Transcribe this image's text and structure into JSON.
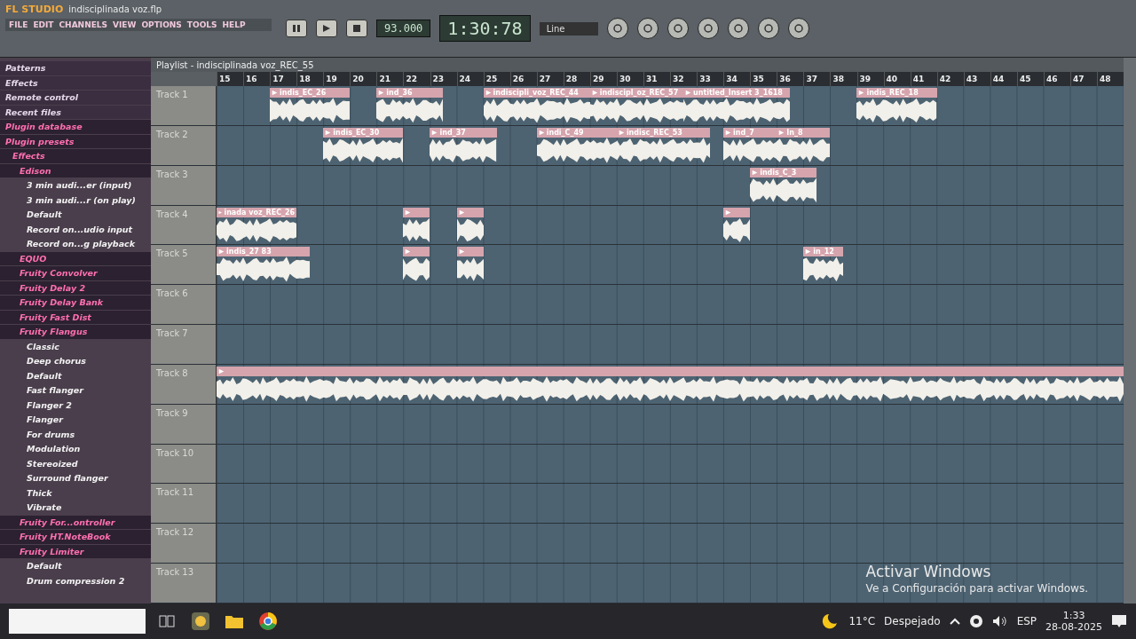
{
  "app": {
    "logo": "FL STUDIO",
    "project": "indisciplinada voz.flp",
    "menu": [
      "FILE",
      "EDIT",
      "CHANNELS",
      "VIEW",
      "OPTIONS",
      "TOOLS",
      "HELP"
    ],
    "tempo": "93.000",
    "time": "1:30:78",
    "snap": "Line"
  },
  "playlist": {
    "title": "Playlist - indisciplinada voz_REC_55",
    "bars": [
      "15",
      "16",
      "17",
      "18",
      "19",
      "20",
      "21",
      "22",
      "23",
      "24",
      "25",
      "26",
      "27",
      "28",
      "29",
      "30",
      "31",
      "32",
      "33",
      "34",
      "35",
      "36",
      "37",
      "38",
      "39",
      "40",
      "41",
      "42",
      "43",
      "44",
      "45",
      "46",
      "47",
      "48"
    ],
    "tracks": [
      {
        "name": "Track 1",
        "clips": [
          {
            "kind": "audio",
            "label": "indis_EC_26"
          },
          {
            "kind": "audio",
            "label": "ind_36"
          },
          {
            "kind": "audio",
            "label": "indiscipli_voz_REC_44"
          },
          {
            "kind": "audio",
            "label": "indiscipl_oz_REC_57"
          },
          {
            "kind": "audio",
            "label": "untitled_Insert 3_1618"
          },
          {
            "kind": "audio",
            "label": "indis_REC_18"
          }
        ]
      },
      {
        "name": "Track 2",
        "clips": [
          {
            "kind": "audio",
            "label": "indis_EC_30"
          },
          {
            "kind": "audio",
            "label": "ind_37"
          },
          {
            "kind": "audio",
            "label": "indi_C_49"
          },
          {
            "kind": "audio",
            "label": "indisc_REC_53"
          },
          {
            "kind": "audio",
            "label": "ind_7"
          },
          {
            "kind": "audio",
            "label": "In_8"
          }
        ]
      },
      {
        "name": "Track 3",
        "clips": [
          {
            "kind": "audio",
            "label": "indis_C_3"
          }
        ]
      },
      {
        "name": "Track 4",
        "clips": [
          {
            "kind": "audio",
            "label": "inada voz_REC_26"
          },
          {
            "kind": "audio"
          },
          {
            "kind": "audio"
          },
          {
            "kind": "audio"
          }
        ]
      },
      {
        "name": "Track 5",
        "clips": [
          {
            "kind": "audio",
            "label": "indis_27 83"
          },
          {
            "kind": "audio"
          },
          {
            "kind": "audio"
          },
          {
            "kind": "audio",
            "label": "in_12"
          }
        ]
      },
      {
        "name": "Track 6"
      },
      {
        "name": "Track 7"
      },
      {
        "name": "Track 8",
        "clips": [
          {
            "kind": "audio"
          }
        ]
      },
      {
        "name": "Track 9"
      },
      {
        "name": "Track 10"
      },
      {
        "name": "Track 11"
      },
      {
        "name": "Track 12"
      },
      {
        "name": "Track 13"
      }
    ]
  },
  "browser": [
    {
      "label": "Patterns",
      "kind": "category"
    },
    {
      "label": "Effects",
      "kind": "category"
    },
    {
      "label": "Remote control",
      "kind": "category"
    },
    {
      "label": "Recent files",
      "kind": "category"
    },
    {
      "label": "Plugin database",
      "kind": "folder"
    },
    {
      "label": "Plugin presets",
      "kind": "folder",
      "children": [
        {
          "label": "Effects",
          "kind": "folder",
          "children": [
            {
              "label": "Edison",
              "kind": "folder",
              "children": [
                {
                  "label": "3 min audi...er (input)",
                  "kind": "file"
                },
                {
                  "label": "3 min audi...r (on play)",
                  "kind": "file"
                },
                {
                  "label": "Default",
                  "kind": "file"
                },
                {
                  "label": "Record on...udio input",
                  "kind": "file"
                },
                {
                  "label": "Record on...g playback",
                  "kind": "file"
                }
              ]
            },
            {
              "label": "EQUO",
              "kind": "folder"
            },
            {
              "label": "Fruity Convolver",
              "kind": "folder"
            },
            {
              "label": "Fruity Delay 2",
              "kind": "folder"
            },
            {
              "label": "Fruity Delay Bank",
              "kind": "folder"
            },
            {
              "label": "Fruity Fast Dist",
              "kind": "folder"
            },
            {
              "label": "Fruity Flangus",
              "kind": "folder",
              "children": [
                {
                  "label": "Classic",
                  "kind": "file"
                },
                {
                  "label": "Deep chorus",
                  "kind": "file"
                },
                {
                  "label": "Default",
                  "kind": "file"
                },
                {
                  "label": "Fast flanger",
                  "kind": "file"
                },
                {
                  "label": "Flanger 2",
                  "kind": "file"
                },
                {
                  "label": "Flanger",
                  "kind": "file"
                },
                {
                  "label": "For drums",
                  "kind": "file"
                },
                {
                  "label": "Modulation",
                  "kind": "file"
                },
                {
                  "label": "Stereoized",
                  "kind": "file"
                },
                {
                  "label": "Surround flanger",
                  "kind": "file"
                },
                {
                  "label": "Thick",
                  "kind": "file"
                },
                {
                  "label": "Vibrate",
                  "kind": "file"
                }
              ]
            },
            {
              "label": "Fruity For...ontroller",
              "kind": "folder"
            },
            {
              "label": "Fruity HT.NoteBook",
              "kind": "folder"
            },
            {
              "label": "Fruity Limiter",
              "kind": "folder",
              "children": [
                {
                  "label": "Default",
                  "kind": "file"
                },
                {
                  "label": "Drum compression 2",
                  "kind": "file"
                }
              ]
            }
          ]
        }
      ]
    }
  ],
  "activation": {
    "title": "Activar Windows",
    "text": "Ve a Configuración para activar Windows."
  },
  "taskbar": {
    "temperature": "11°C",
    "weather": "Despejado",
    "language": "ESP",
    "time": "1:33",
    "date": "28-08-2025"
  }
}
